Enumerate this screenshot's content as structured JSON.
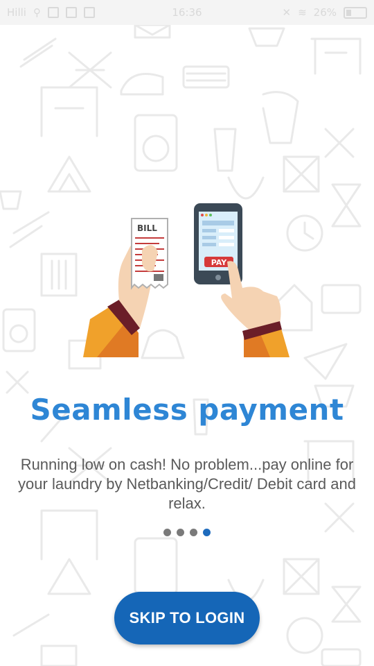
{
  "status_bar": {
    "carrier": "Hilli",
    "time": "16:36",
    "battery": "26%"
  },
  "slide": {
    "title": "Seamless payment",
    "description": "Running low on cash! No problem...pay online for your laundry by Netbanking/Credit/ Debit card and relax.",
    "bill_label": "BILL",
    "pay_label": "PAY"
  },
  "pager": {
    "total": 4,
    "current": 4
  },
  "skip_button": {
    "label": "SKIP TO LOGIN"
  },
  "colors": {
    "accent": "#2e86d5",
    "button": "#1566b7"
  }
}
